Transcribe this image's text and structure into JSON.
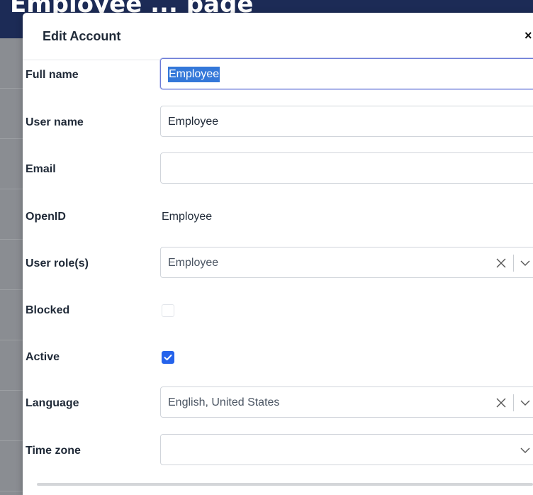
{
  "background": {
    "page_title": "Employee ... page"
  },
  "modal": {
    "title": "Edit Account",
    "close_glyph": "×",
    "fields": {
      "full_name": {
        "label": "Full name",
        "value": "Employee"
      },
      "user_name": {
        "label": "User name",
        "value": "Employee"
      },
      "email": {
        "label": "Email",
        "value": ""
      },
      "openid": {
        "label": "OpenID",
        "value": "Employee"
      },
      "user_roles": {
        "label": "User role(s)",
        "value": "Employee"
      },
      "blocked": {
        "label": "Blocked",
        "checked": false
      },
      "active": {
        "label": "Active",
        "checked": true
      },
      "language": {
        "label": "Language",
        "value": "English, United States"
      },
      "time_zone": {
        "label": "Time zone",
        "value": ""
      }
    }
  },
  "colors": {
    "accent": "#2563eb",
    "header_bg": "#1c2b56",
    "overlay": "#8a8d92"
  },
  "icons": {
    "close": "close-icon",
    "clear": "clear-icon",
    "dropdown": "chevron-down-icon",
    "check": "check-icon"
  }
}
